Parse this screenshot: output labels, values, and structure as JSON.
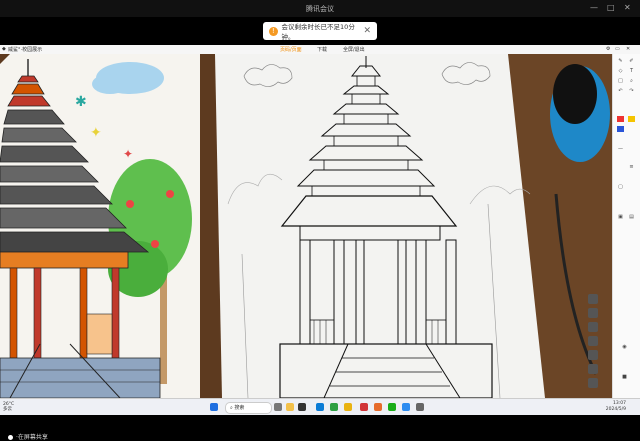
{
  "window": {
    "title": "腾讯会议"
  },
  "notice": {
    "text": "会议剩余时长已不足10分钟。",
    "close": "✕"
  },
  "inner_tabs": {
    "app_title": "威鲨°·校园展示",
    "left": "页码/页面",
    "middle": "下载",
    "right": "全屏/退出"
  },
  "taskbar": {
    "search_placeholder": "搜索",
    "weather_temp": "26°C",
    "weather_desc": "多云",
    "time": "13:07",
    "date": "2024/5/9"
  },
  "status": {
    "sharer": "·在屏幕共享"
  },
  "colors": {
    "accent": "#f59a23",
    "tab_active": "#f08a00"
  }
}
